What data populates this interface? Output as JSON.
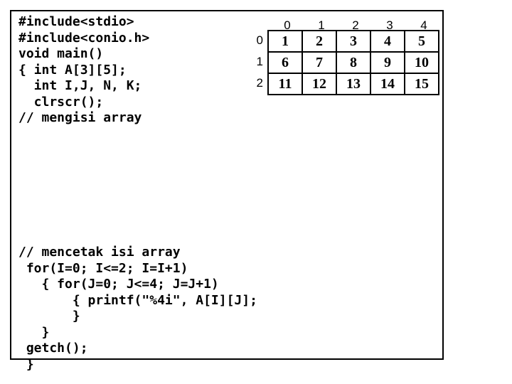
{
  "code_top": "#include<stdio>\n#include<conio.h>\nvoid main()\n{ int A[3][5];\n  int I,J, N, K;\n  clrscr();\n// mengisi array",
  "code_bottom": "// mencetak isi array\n for(I=0; I<=2; I=I+1)\n   { for(J=0; J<=4; J=J+1)\n       { printf(\"%4i\", A[I][J];\n       }\n   }\n getch();\n }",
  "array": {
    "col_headers": [
      "0",
      "1",
      "2",
      "3",
      "4"
    ],
    "row_headers": [
      "0",
      "1",
      "2"
    ],
    "rows": [
      [
        "1",
        "2",
        "3",
        "4",
        "5"
      ],
      [
        "6",
        "7",
        "8",
        "9",
        "10"
      ],
      [
        "11",
        "12",
        "13",
        "14",
        "15"
      ]
    ]
  }
}
